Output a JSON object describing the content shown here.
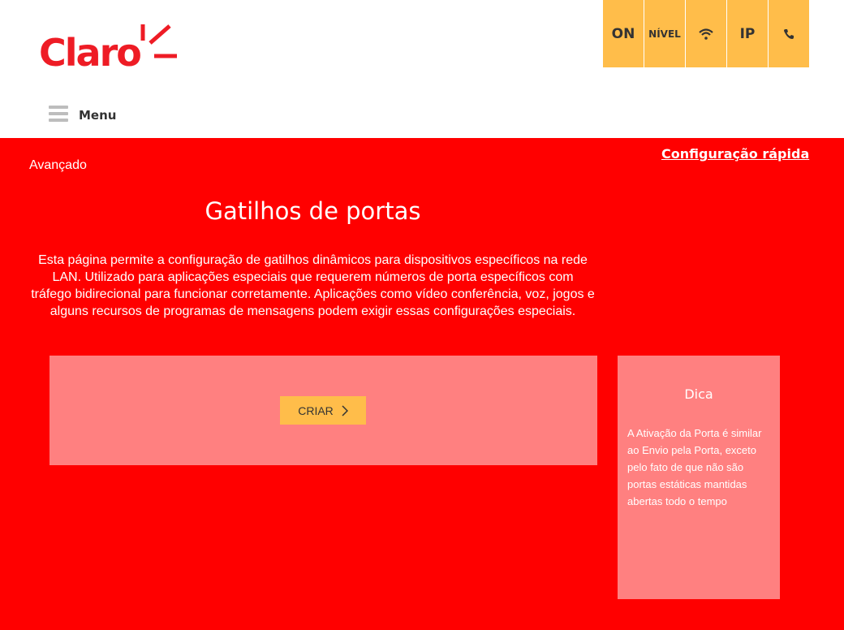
{
  "brand": {
    "name": "Claro",
    "color": "#ee1c25"
  },
  "status_bar": {
    "color": "#ffbd4a",
    "items": [
      {
        "label": "ON"
      },
      {
        "label": "NÍVEL"
      },
      {
        "icon": "wifi-icon"
      },
      {
        "label": "IP"
      },
      {
        "icon": "phone-icon"
      }
    ]
  },
  "menu": {
    "label": "Menu",
    "icon": "hamburger-icon"
  },
  "breadcrumb": "Avançado",
  "quick_config": "Configuração rápida",
  "page": {
    "title": "Gatilhos de portas",
    "description": "Esta página permite a configuração de gatilhos dinâmicos para dispositivos específicos na rede LAN. Utilizado para aplicações especiais que requerem números de porta específicos com tráfego bidirecional para funcionar corretamente. Aplicações como vídeo conferência, voz, jogos e alguns recursos de programas de mensagens podem exigir essas configurações especiais."
  },
  "actions": {
    "create_label": "CRIAR",
    "create_icon": "chevron-right-icon"
  },
  "tip": {
    "title": "Dica",
    "text": "A Ativação da Porta é similar ao Envio pela Porta, exceto pelo fato de que não são portas estáticas mantidas abertas todo o tempo"
  },
  "colors": {
    "background": "#ff0000",
    "panel": "#ff8080",
    "accent": "#ffbd4a"
  }
}
